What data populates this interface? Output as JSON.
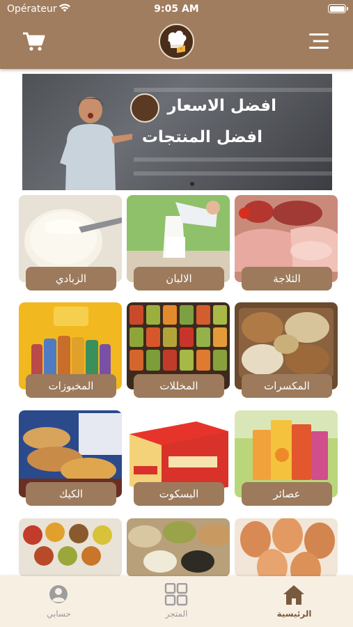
{
  "status_bar": {
    "carrier": "Opérateur",
    "time": "9:05 AM"
  },
  "header": {
    "cart_icon": "cart-icon",
    "menu_icon": "menu-icon",
    "logo": "chef-logo"
  },
  "banner": {
    "line1": "افضل الاسعار",
    "line2": "افضل المنتجات",
    "page_indicator": "1 of 1"
  },
  "categories": [
    {
      "label": "الزبادي"
    },
    {
      "label": "الالبان"
    },
    {
      "label": "الثلاجة"
    },
    {
      "label": "المخبوزات"
    },
    {
      "label": "المخللات"
    },
    {
      "label": "المكسرات"
    },
    {
      "label": "الكيك"
    },
    {
      "label": "البسكوت"
    },
    {
      "label": "عصائر"
    }
  ],
  "bottom_nav": {
    "items": [
      {
        "label": "حسابي",
        "icon": "person-icon"
      },
      {
        "label": "المتجر",
        "icon": "grid-icon"
      },
      {
        "label": "الرئيسية",
        "icon": "home-icon",
        "active": true
      }
    ]
  },
  "colors": {
    "header_bg": "#a07d5e",
    "label_bg": "#9c7a5b",
    "nav_bg": "#f8efe3",
    "active_nav": "#7a5a3e"
  }
}
